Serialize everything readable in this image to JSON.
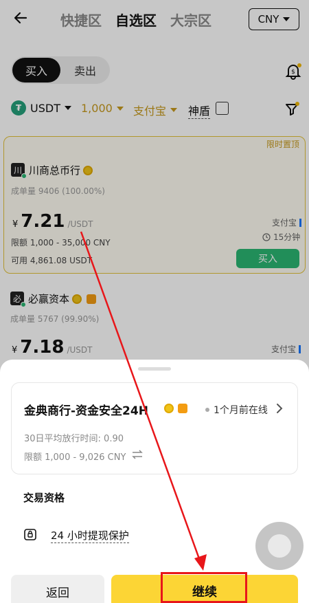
{
  "nav": {
    "tabs": [
      "快捷区",
      "自选区",
      "大宗区"
    ],
    "currency": "CNY"
  },
  "trade_toggle": {
    "buy": "买入",
    "sell": "卖出"
  },
  "filters": {
    "asset": "USDT",
    "amount": "1,000",
    "payment": "支付宝",
    "shield": "神盾"
  },
  "listings": [
    {
      "pinned_badge": "限时置顶",
      "avatar": "川",
      "name": "川商总币行",
      "orders": "成单量 9406 (100.00%)",
      "currency_symbol": "¥",
      "price": "7.21",
      "unit": "/USDT",
      "limit": "限额 1,000 - 35,000 CNY",
      "available": "可用 4,861.08 USDT",
      "payment": "支付宝",
      "time": "15分钟",
      "action": "买入"
    },
    {
      "avatar": "必",
      "name": "必赢资本",
      "orders": "成单量 5767 (99.90%)",
      "currency_symbol": "¥",
      "price": "7.18",
      "unit": "/USDT",
      "payment": "支付宝"
    }
  ],
  "sheet": {
    "merchant": "金典商行-资金安全24H",
    "online": "1个月前在线",
    "avg_release": "30日平均放行时间: 0.90",
    "limit": "限额 1,000 - 9,026 CNY",
    "section_title": "交易资格",
    "protection": "24 小时提现保护",
    "return_label": "返回",
    "continue_label": "继续"
  },
  "colors": {
    "accent_yellow": "#fcd535",
    "buy_green": "#2bb673",
    "highlight_red": "#e8161a"
  }
}
